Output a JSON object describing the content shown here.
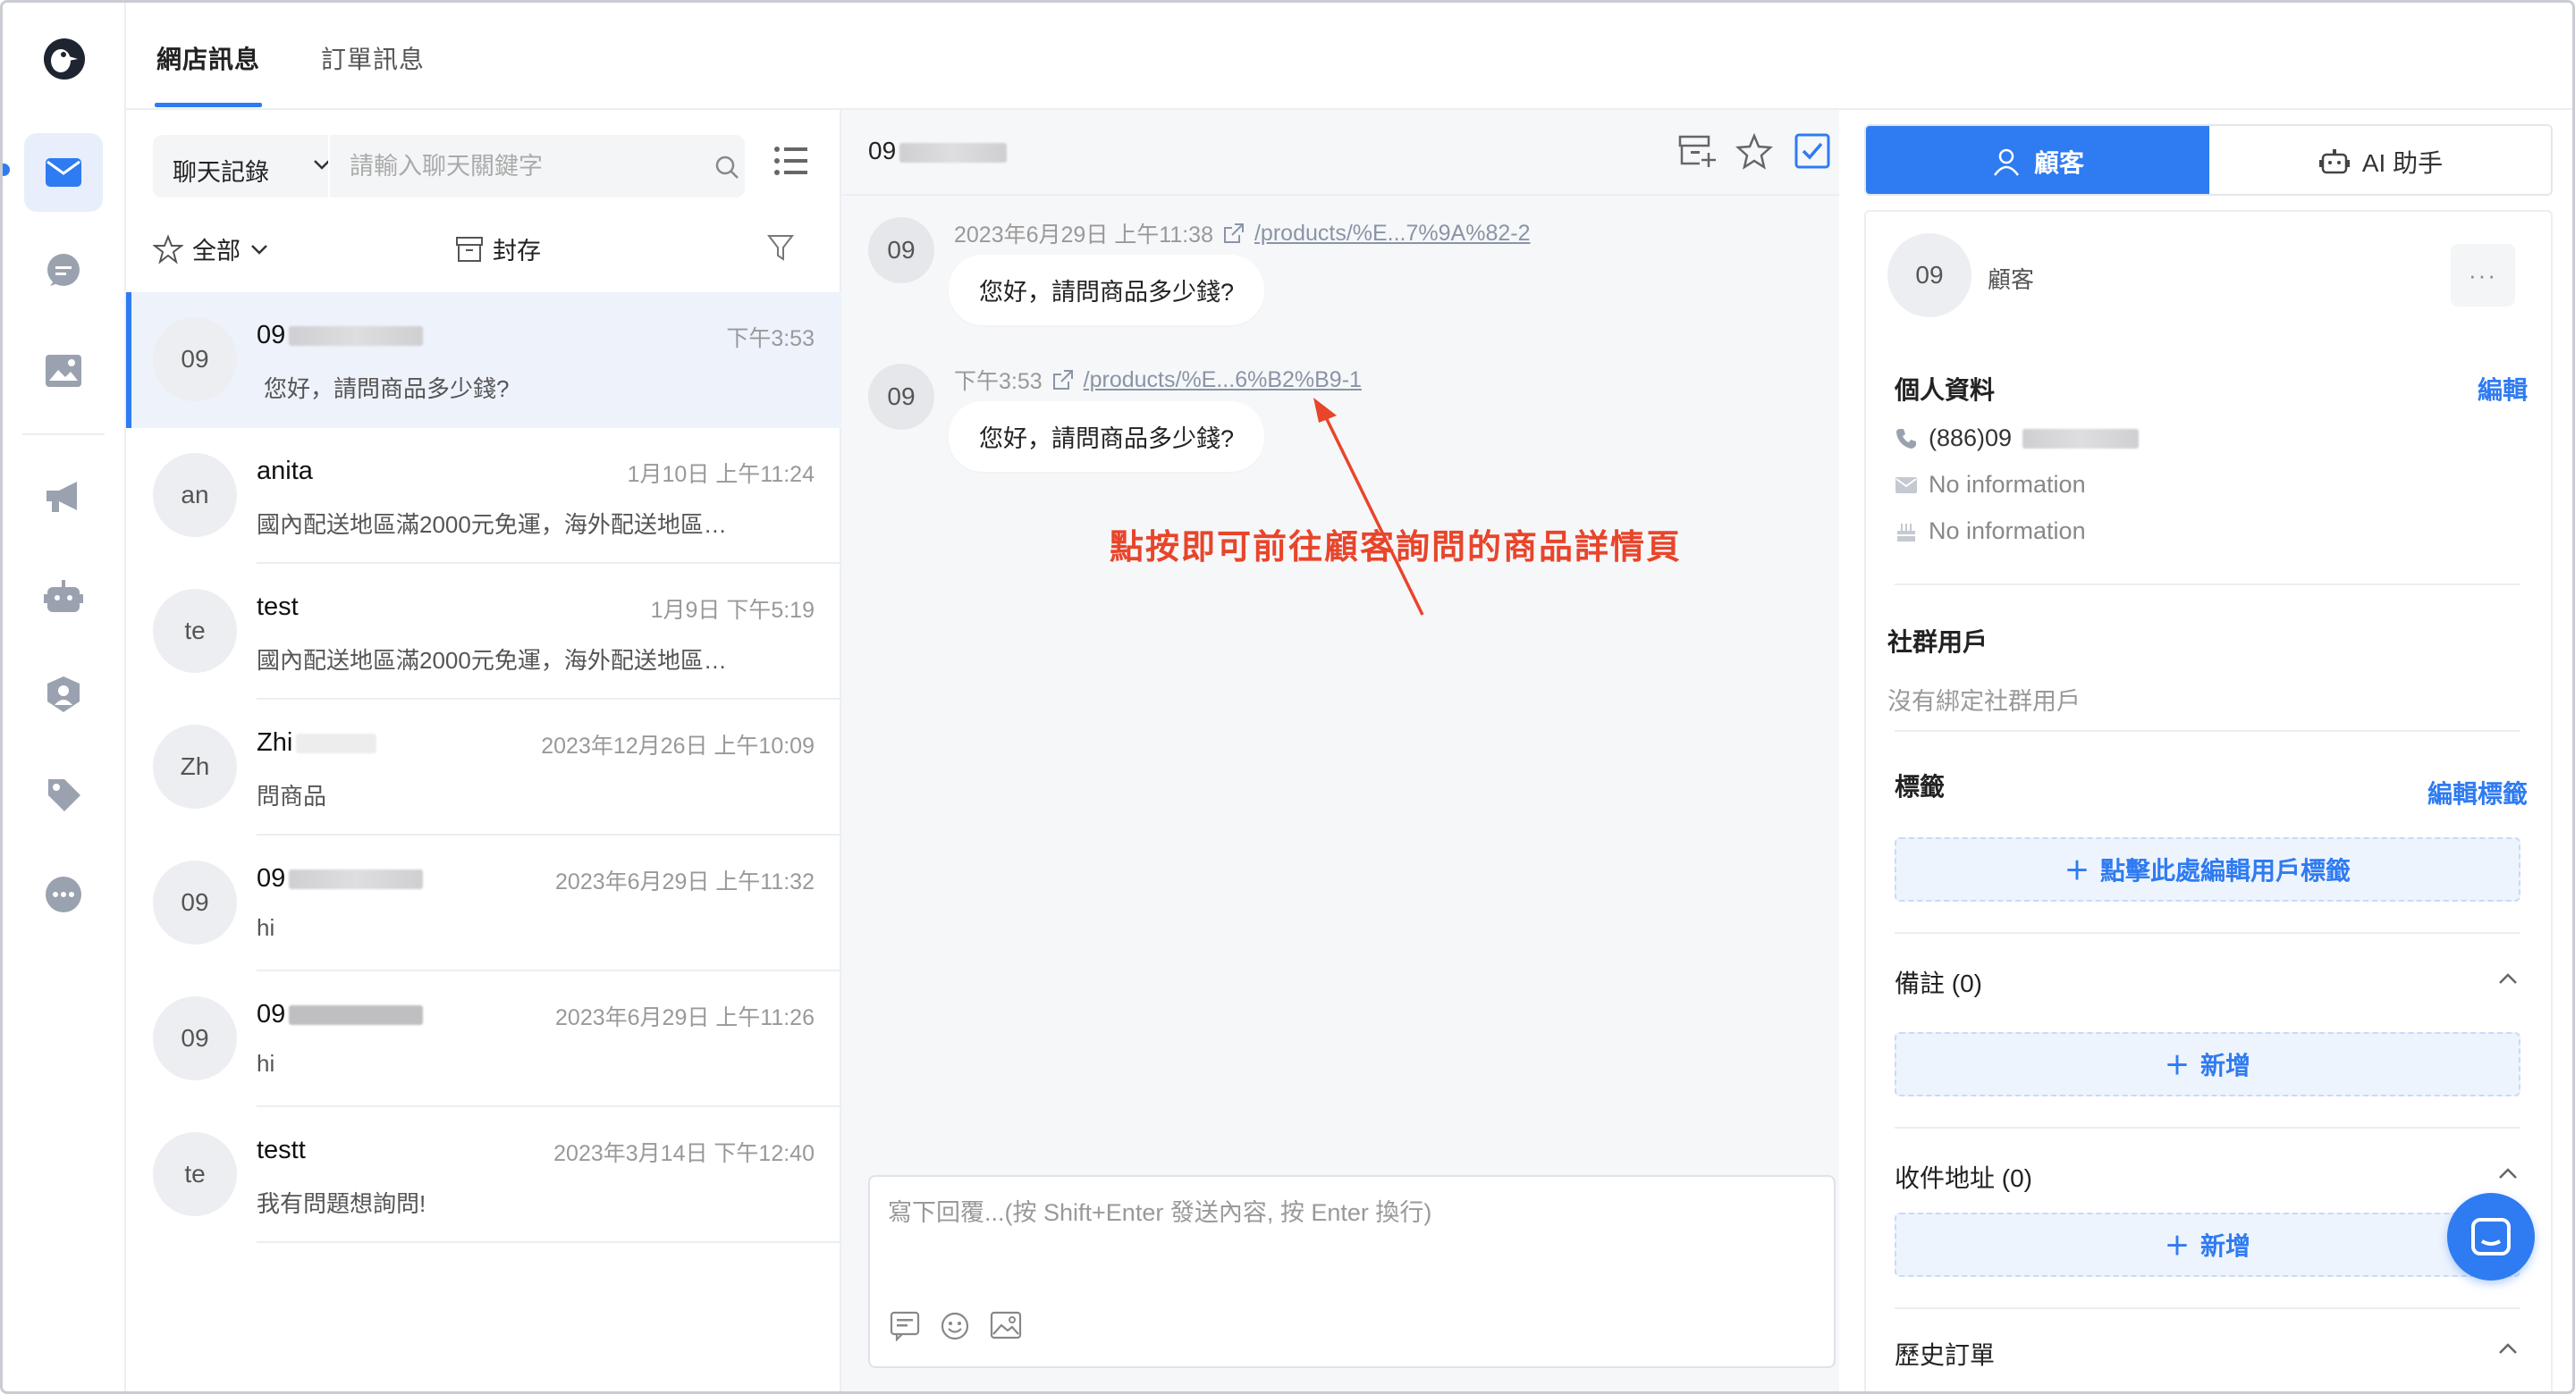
{
  "app": {
    "logo_icon": "penguin-logo-icon",
    "accent": "#2f7bf1",
    "annotation_color": "#e8452b"
  },
  "rail": {
    "items": [
      {
        "name": "inbox-icon",
        "active": true
      },
      {
        "name": "chat-bubble-icon"
      },
      {
        "name": "gallery-icon"
      },
      {
        "name": "megaphone-icon"
      },
      {
        "name": "robot-icon"
      },
      {
        "name": "customer-service-icon"
      },
      {
        "name": "tag-icon"
      },
      {
        "name": "more-icon"
      }
    ]
  },
  "top_tabs": [
    {
      "label": "網店訊息",
      "active": true
    },
    {
      "label": "訂單訊息",
      "active": false
    }
  ],
  "conv_list": {
    "select_label": "聊天記錄",
    "search_placeholder": "請輸入聊天關鍵字",
    "filter_all": "全部",
    "filter_archive": "封存",
    "items": [
      {
        "avatar": "09",
        "name": "09",
        "time": "下午3:53",
        "preview": "您好，請問商品多少錢?",
        "active": true
      },
      {
        "avatar": "an",
        "name": "anita",
        "time": "1月10日 上午11:24",
        "preview": "國內配送地區滿2000元免運，海外配送地區…"
      },
      {
        "avatar": "te",
        "name": "test",
        "time": "1月9日 下午5:19",
        "preview": "國內配送地區滿2000元免運，海外配送地區…"
      },
      {
        "avatar": "Zh",
        "name": "Zhi",
        "time": "2023年12月26日 上午10:09",
        "preview": "問商品"
      },
      {
        "avatar": "09",
        "name": "09",
        "time": "2023年6月29日 上午11:32",
        "preview": "hi"
      },
      {
        "avatar": "09",
        "name": "09",
        "time": "2023年6月29日 上午11:26",
        "preview": "hi"
      },
      {
        "avatar": "te",
        "name": "testt",
        "time": "2023年3月14日 下午12:40",
        "preview": "我有問題想詢問!"
      }
    ]
  },
  "chat": {
    "title": "09",
    "messages": [
      {
        "avatar": "09",
        "time": "2023年6月29日 上午11:38",
        "link": "/products/%E...7%9A%82-2",
        "text": "您好，請問商品多少錢?"
      },
      {
        "avatar": "09",
        "time": "下午3:53",
        "link": "/products/%E...6%B2%B9-1",
        "text": "您好，請問商品多少錢?"
      }
    ],
    "annotation": "點按即可前往顧客詢問的商品詳情頁",
    "composer_placeholder": "寫下回覆...(按 Shift+Enter 發送內容, 按 Enter 換行)"
  },
  "right": {
    "tab_customer": "顧客",
    "tab_ai": "AI 助手",
    "avatar": "09",
    "customer_label": "顧客",
    "profile_title": "個人資料",
    "edit": "編輯",
    "phone": "(886)09",
    "email": "No information",
    "birthday": "No information",
    "social_title": "社群用戶",
    "social_empty": "沒有綁定社群用戶",
    "tags_title": "標籤",
    "edit_tags": "編輯標籤",
    "add_tags": "點擊此處編輯用戶標籤",
    "notes_title": "備註 (0)",
    "add_new": "新增",
    "address_title": "收件地址 (0)",
    "add_new2": "新增",
    "orders_title": "歷史訂單"
  }
}
